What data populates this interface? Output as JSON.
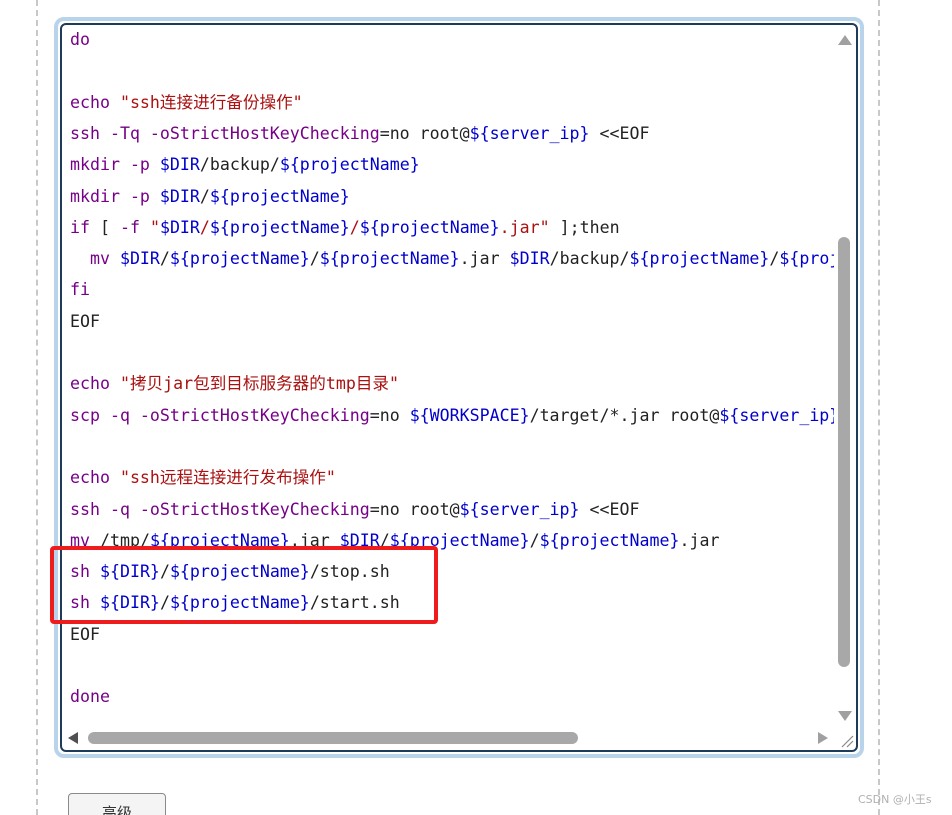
{
  "editor": {
    "lines": [
      [
        {
          "t": "do",
          "c": "kw"
        }
      ],
      [],
      [
        {
          "t": "echo ",
          "c": "kw"
        },
        {
          "t": "\"ssh连接进行备份操作\"",
          "c": "str"
        }
      ],
      [
        {
          "t": "ssh -Tq -oStrictHostKeyChecking",
          "c": "kw"
        },
        {
          "t": "=no root@",
          "c": "txt"
        },
        {
          "t": "${server_ip}",
          "c": "var"
        },
        {
          "t": " <<EOF",
          "c": "txt"
        }
      ],
      [
        {
          "t": "mkdir -p ",
          "c": "kw"
        },
        {
          "t": "$DIR",
          "c": "var"
        },
        {
          "t": "/backup/",
          "c": "txt"
        },
        {
          "t": "${projectName}",
          "c": "var"
        }
      ],
      [
        {
          "t": "mkdir -p ",
          "c": "kw"
        },
        {
          "t": "$DIR",
          "c": "var"
        },
        {
          "t": "/",
          "c": "txt"
        },
        {
          "t": "${projectName}",
          "c": "var"
        }
      ],
      [
        {
          "t": "if",
          "c": "kw"
        },
        {
          "t": " [ ",
          "c": "txt"
        },
        {
          "t": "-f ",
          "c": "kw"
        },
        {
          "t": "\"",
          "c": "str"
        },
        {
          "t": "$DIR",
          "c": "var"
        },
        {
          "t": "/",
          "c": "str"
        },
        {
          "t": "${projectName}",
          "c": "var"
        },
        {
          "t": "/",
          "c": "str"
        },
        {
          "t": "${projectName}",
          "c": "var"
        },
        {
          "t": ".jar\"",
          "c": "str"
        },
        {
          "t": " ];then",
          "c": "txt"
        }
      ],
      [
        {
          "t": "  mv ",
          "c": "kw"
        },
        {
          "t": "$DIR",
          "c": "var"
        },
        {
          "t": "/",
          "c": "txt"
        },
        {
          "t": "${projectName}",
          "c": "var"
        },
        {
          "t": "/",
          "c": "txt"
        },
        {
          "t": "${projectName}",
          "c": "var"
        },
        {
          "t": ".jar ",
          "c": "txt"
        },
        {
          "t": "$DIR",
          "c": "var"
        },
        {
          "t": "/backup/",
          "c": "txt"
        },
        {
          "t": "${projectName}",
          "c": "var"
        },
        {
          "t": "/",
          "c": "txt"
        },
        {
          "t": "${proje",
          "c": "var"
        }
      ],
      [
        {
          "t": "fi",
          "c": "kw"
        }
      ],
      [
        {
          "t": "EOF",
          "c": "txt"
        }
      ],
      [],
      [
        {
          "t": "echo ",
          "c": "kw"
        },
        {
          "t": "\"拷贝jar包到目标服务器的tmp目录\"",
          "c": "str"
        }
      ],
      [
        {
          "t": "scp -q -oStrictHostKeyChecking",
          "c": "kw"
        },
        {
          "t": "=no ",
          "c": "txt"
        },
        {
          "t": "${WORKSPACE}",
          "c": "var"
        },
        {
          "t": "/target/*.jar root@",
          "c": "txt"
        },
        {
          "t": "${server_ip}",
          "c": "var"
        },
        {
          "t": ":",
          "c": "txt"
        }
      ],
      [],
      [
        {
          "t": "echo ",
          "c": "kw"
        },
        {
          "t": "\"ssh远程连接进行发布操作\"",
          "c": "str"
        }
      ],
      [
        {
          "t": "ssh -q -oStrictHostKeyChecking",
          "c": "kw"
        },
        {
          "t": "=no root@",
          "c": "txt"
        },
        {
          "t": "${server_ip}",
          "c": "var"
        },
        {
          "t": " <<EOF",
          "c": "txt"
        }
      ],
      [
        {
          "t": "mv ",
          "c": "kw"
        },
        {
          "t": "/tmp/",
          "c": "txt"
        },
        {
          "t": "${projectName}",
          "c": "var"
        },
        {
          "t": ".jar ",
          "c": "txt"
        },
        {
          "t": "$DIR",
          "c": "var"
        },
        {
          "t": "/",
          "c": "txt"
        },
        {
          "t": "${projectName}",
          "c": "var"
        },
        {
          "t": "/",
          "c": "txt"
        },
        {
          "t": "${projectName}",
          "c": "var"
        },
        {
          "t": ".jar",
          "c": "txt"
        }
      ],
      [
        {
          "t": "sh ",
          "c": "kw"
        },
        {
          "t": "${DIR}",
          "c": "var"
        },
        {
          "t": "/",
          "c": "txt"
        },
        {
          "t": "${projectName}",
          "c": "var"
        },
        {
          "t": "/stop.sh",
          "c": "txt"
        }
      ],
      [
        {
          "t": "sh ",
          "c": "kw"
        },
        {
          "t": "${DIR}",
          "c": "var"
        },
        {
          "t": "/",
          "c": "txt"
        },
        {
          "t": "${projectName}",
          "c": "var"
        },
        {
          "t": "/start.sh",
          "c": "txt"
        }
      ],
      [
        {
          "t": "EOF",
          "c": "txt"
        }
      ],
      [],
      [
        {
          "t": "done",
          "c": "kw"
        }
      ]
    ]
  },
  "advanced_button_label": "高级",
  "watermark": "CSDN @小王s",
  "colors": {
    "keyword": "#770088",
    "string": "#aa1111",
    "variable": "#0000cc",
    "highlight": "#ee1c1c",
    "editor_border": "#b9d4ea"
  }
}
